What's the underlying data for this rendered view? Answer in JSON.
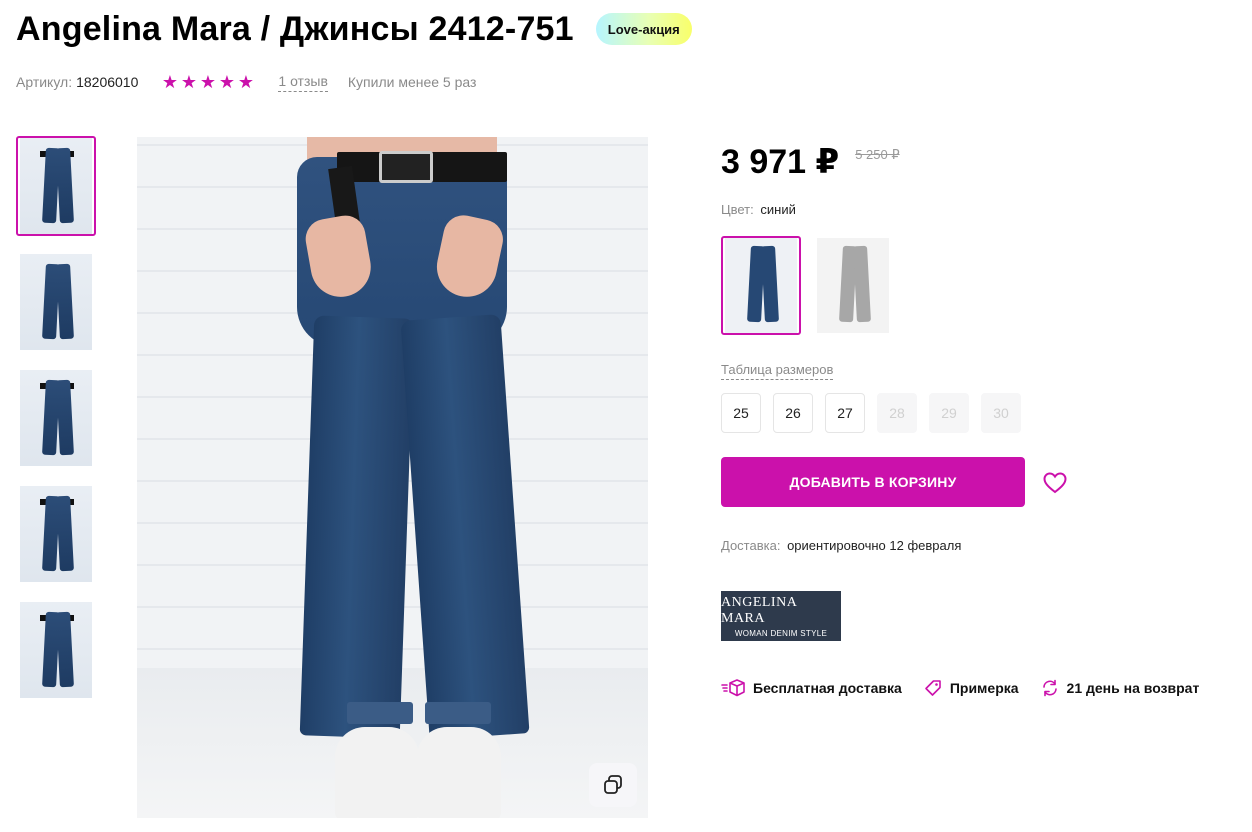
{
  "product": {
    "title": "Angelina Mara / Джинсы 2412-751",
    "promo_badge": "Love-акция",
    "article_label": "Артикул:",
    "article_value": "18206010",
    "rating_stars": 5,
    "reviews_link": "1 отзыв",
    "purchases_text": "Купили менее 5 раз"
  },
  "gallery": {
    "thumbnails": [
      {
        "icon": "jeans-front-photo",
        "active": true
      },
      {
        "icon": "jeans-side-photo",
        "active": false
      },
      {
        "icon": "jeans-front-full-photo",
        "active": false
      },
      {
        "icon": "jeans-back-photo",
        "active": false
      },
      {
        "icon": "jeans-belt-closeup-photo",
        "active": false
      }
    ],
    "zoom_icon": "copy-icon"
  },
  "pricing": {
    "current_price": "3 971 ₽",
    "old_price": "5 250 ₽"
  },
  "color": {
    "label": "Цвет:",
    "value": "синий",
    "swatches": [
      "синий",
      "серый"
    ]
  },
  "sizes": {
    "table_link": "Таблица размеров",
    "options": [
      {
        "label": "25",
        "available": true
      },
      {
        "label": "26",
        "available": true
      },
      {
        "label": "27",
        "available": true
      },
      {
        "label": "28",
        "available": false
      },
      {
        "label": "29",
        "available": false
      },
      {
        "label": "30",
        "available": false
      }
    ]
  },
  "actions": {
    "add_to_cart": "ДОБАВИТЬ В КОРЗИНУ",
    "wishlist_icon": "heart-icon"
  },
  "delivery": {
    "label": "Доставка:",
    "value": "ориентировочно 12 февраля"
  },
  "brand": {
    "name": "ANGELINA MARA",
    "tagline": "WOMAN DENIM STYLE"
  },
  "benefits": [
    {
      "icon": "delivery-box-icon",
      "label": "Бесплатная доставка"
    },
    {
      "icon": "tag-icon",
      "label": "Примерка"
    },
    {
      "icon": "return-arrows-icon",
      "label": "21 день на возврат"
    }
  ],
  "colors": {
    "accent": "#cb11ab",
    "brand_logo_bg": "#2e3a4c"
  }
}
